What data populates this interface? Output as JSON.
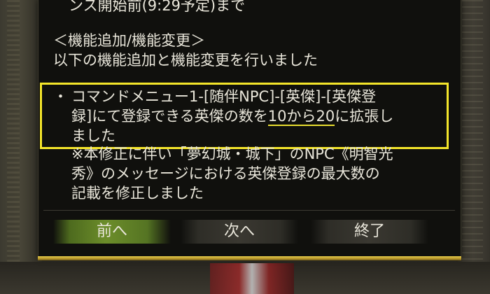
{
  "message": {
    "top_line": "ンス開始前(9:29予定)まで",
    "section_heading": "＜機能追加/機能変更＞",
    "section_intro": "以下の機能追加と機能変更を行いました",
    "bullet": "・",
    "item_line1": "コマンドメニュー1-[随伴NPC]-[英傑]-[英傑登",
    "item_line2_pre": "録]にて登録できる英傑の数を",
    "item_line2_highlight": "10から20",
    "item_line2_post": "に拡張し",
    "item_line3": "ました",
    "note_line1": "※本修正に伴い「夢幻城・城下」のNPC《明智光",
    "note_line2": "秀》のメッセージにおける英傑登録の最大数の",
    "note_line3": "記載を修正しました"
  },
  "buttons": {
    "prev": "前へ",
    "next": "次へ",
    "close": "終了"
  },
  "colors": {
    "highlight_border": "#f4e52a",
    "dialog_gold_border": "#e2c94a",
    "active_button": "#6c8d2a",
    "text": "#e9e6da"
  }
}
